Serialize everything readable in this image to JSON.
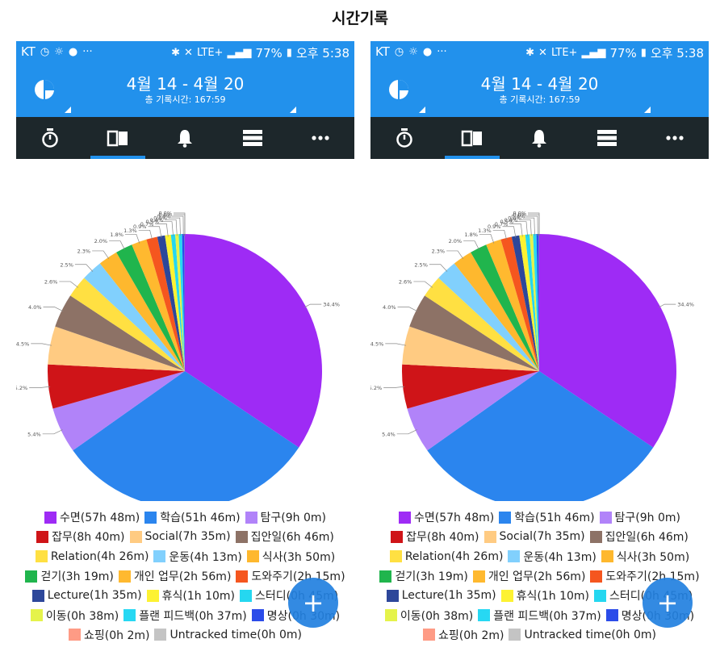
{
  "page_title": "시간기록",
  "status_bar": {
    "carrier": "KT",
    "battery": "77%",
    "time": "오후 5:38",
    "network": "LTE+"
  },
  "app_bar": {
    "date_range": "4월 14 - 4월 20",
    "total_time": "총 기록시간: 167:59"
  },
  "tabs": [
    {
      "name": "timer-icon",
      "active": false
    },
    {
      "name": "book-icon",
      "active": true
    },
    {
      "name": "bell-icon",
      "active": false
    },
    {
      "name": "list-icon",
      "active": false
    },
    {
      "name": "more-icon",
      "active": false
    }
  ],
  "fab": {
    "label": "+"
  },
  "chart_data": {
    "type": "pie",
    "title": "",
    "slices": [
      {
        "label": "수면(57h 48m)",
        "value": 34.4,
        "pct": "34.4%",
        "color": "#9e2bf5"
      },
      {
        "label": "학습(51h 46m)",
        "value": 30.8,
        "pct": "30.8%",
        "color": "#2b85ee"
      },
      {
        "label": "탐구(9h 0m)",
        "value": 5.4,
        "pct": "5.4%",
        "color": "#b183f9"
      },
      {
        "label": "잡무(8h 40m)",
        "value": 5.2,
        "pct": "5.2%",
        "color": "#cf1418"
      },
      {
        "label": "Social(7h 35m)",
        "value": 4.5,
        "pct": "4.5%",
        "color": "#ffcb82"
      },
      {
        "label": "집안일(6h 46m)",
        "value": 4.0,
        "pct": "4.0%",
        "color": "#8d7266"
      },
      {
        "label": "Relation(4h 26m)",
        "value": 2.6,
        "pct": "2.6%",
        "color": "#ffe042"
      },
      {
        "label": "운동(4h 13m)",
        "value": 2.5,
        "pct": "2.5%",
        "color": "#81d0fd"
      },
      {
        "label": "식사(3h 50m)",
        "value": 2.3,
        "pct": "2.3%",
        "color": "#feb82e"
      },
      {
        "label": "걷기(3h 19m)",
        "value": 2.0,
        "pct": "2.0%",
        "color": "#20b54d"
      },
      {
        "label": "개인 업무(2h 56m)",
        "value": 1.8,
        "pct": "1.8%",
        "color": "#ffb92f"
      },
      {
        "label": "도와주기(2h 15m)",
        "value": 1.3,
        "pct": "1.3%",
        "color": "#f5561f"
      },
      {
        "label": "Lecture(1h 35m)",
        "value": 0.9,
        "pct": "0.9%",
        "color": "#2d479a"
      },
      {
        "label": "휴식(1h 10m)",
        "value": 0.7,
        "pct": "0.7%",
        "color": "#fdf232"
      },
      {
        "label": "스터디(0h 45m)",
        "value": 0.5,
        "pct": "0.5%",
        "color": "#25d7f0"
      },
      {
        "label": "이동(0h 38m)",
        "value": 0.4,
        "pct": "0.4%",
        "color": "#e5f34b"
      },
      {
        "label": "플랜 피드백(0h 37m)",
        "value": 0.4,
        "pct": "0.4%",
        "color": "#27d8f3"
      },
      {
        "label": "명상(0h 30m)",
        "value": 0.3,
        "pct": "0.3%",
        "color": "#2b4ce9"
      },
      {
        "label": "쇼핑(0h 2m)",
        "value": 0.02,
        "pct": "0.0%",
        "color": "#fe9b85"
      },
      {
        "label": "Untracked time(0h 0m)",
        "value": 0.0,
        "pct": "0.0%",
        "color": "#c4c4c4"
      }
    ],
    "legend_rows": [
      [
        0,
        1,
        2
      ],
      [
        3,
        4,
        5
      ],
      [
        6,
        7,
        8
      ],
      [
        9,
        10,
        11
      ],
      [
        12,
        13,
        14
      ],
      [
        15,
        16,
        17
      ],
      [
        18,
        19
      ]
    ]
  }
}
